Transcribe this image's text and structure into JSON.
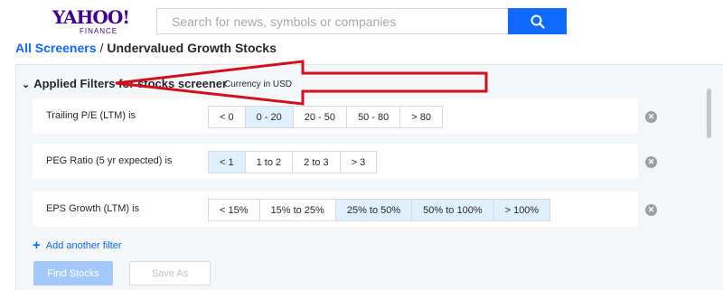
{
  "logo": {
    "main": "YAHOO!",
    "sub": "FINANCE"
  },
  "search": {
    "placeholder": "Search for news, symbols or companies"
  },
  "breadcrumb": {
    "link": "All Screeners",
    "separator": "/",
    "current": "Undervalued Growth Stocks"
  },
  "applied": {
    "title": "Applied Filters for stocks screener",
    "currency": "Currency in USD"
  },
  "filters": [
    {
      "label": "Trailing P/E (LTM)  is",
      "options": [
        "< 0",
        "0 - 20",
        "20 - 50",
        "50 - 80",
        "> 80"
      ],
      "selected": [
        1
      ]
    },
    {
      "label": "PEG Ratio (5 yr expected)  is",
      "options": [
        "< 1",
        "1 to 2",
        "2 to 3",
        "> 3"
      ],
      "selected": [
        0
      ]
    },
    {
      "label": "EPS Growth (LTM)  is",
      "options": [
        "< 15%",
        "15% to 25%",
        "25% to 50%",
        "50% to 100%",
        "> 100%"
      ],
      "selected": [
        2,
        3,
        4
      ]
    }
  ],
  "add_filter": "Add another filter",
  "buttons": {
    "find": "Find Stocks",
    "save_as": "Save As"
  },
  "colors": {
    "accent": "#0f69ff",
    "brand": "#400090",
    "arrow": "#d0101e",
    "selected": "#e0f0ff"
  },
  "icons": {
    "search": "search-icon",
    "chevron": "chevron-down-icon",
    "remove": "remove-filter-icon",
    "add": "plus-icon"
  }
}
